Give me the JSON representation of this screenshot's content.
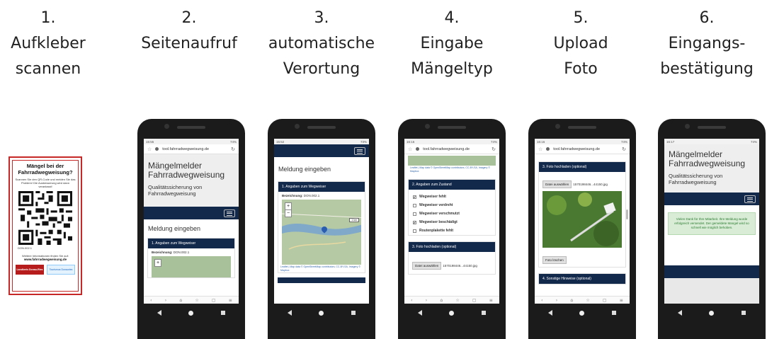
{
  "steps": [
    {
      "num": "1.",
      "line1": "Aufkleber",
      "line2": "scannen"
    },
    {
      "num": "2.",
      "line1": "Seitenaufruf",
      "line2": ""
    },
    {
      "num": "3.",
      "line1": "automatische",
      "line2": "Verortung"
    },
    {
      "num": "4.",
      "line1": "Eingabe",
      "line2": "Mängeltyp"
    },
    {
      "num": "5.",
      "line1": "Upload",
      "line2": "Foto"
    },
    {
      "num": "6.",
      "line1": "Eingangs-",
      "line2": "bestätigung"
    }
  ],
  "sticker": {
    "title": "Mängel bei der Fahrradwegweisung?",
    "text": "Scannen Sie den QR-Code und melden Sie das Problem! Die Ausbesserung wird dann veranlasst!",
    "id": "DON.002.1",
    "info": "Weitere Informationen finden Sie auf:",
    "url": "www.fahrradwegweisung.de",
    "logo_left": "Landkreis Donau-Ries",
    "logo_right": "Tourismus Donauries"
  },
  "phones": {
    "url": "tool.fahrradwegweisung.de",
    "app_title": "Mängelmelder Fahrradwegweisung",
    "app_subtitle": "Qualitätssicherung von Fahrradwegweisung",
    "status_times": [
      "15:55",
      "15:52",
      "16:16",
      "16:16",
      "16:17"
    ],
    "status_battery": [
      "74%",
      "73%",
      "74%",
      "74%",
      "74%"
    ],
    "page_heading": "Meldung eingeben",
    "section1": "1. Angaben zum Wegweiser",
    "bezeichnung_label": "Bezeichnung:",
    "bezeichnung_value": "DON.002.1",
    "map_attrib": "Leaflet | Map data © OpenStreetMap contributors, CC-BY-SA, Imagery © Mapbox",
    "map_scale": "1 km",
    "section2": "2. Angaben zum Zustand",
    "options": [
      {
        "label": "Wegweiser fehlt",
        "checked": true
      },
      {
        "label": "Wegweiser verdreht",
        "checked": false
      },
      {
        "label": "Wegweiser verschmutzt",
        "checked": false
      },
      {
        "label": "Wegweiser beschädigt",
        "checked": true
      },
      {
        "label": "Routenplakette fehlt",
        "checked": false
      }
    ],
    "section3": "3. Foto hochladen (optional)",
    "file_button": "Datei auswählen",
    "file_name": "1570198446...44150.jpg",
    "delete_photo": "Foto löschen",
    "section4": "4. Sonstige Hinweise (optional)",
    "success_text": "Vielen Dank für Ihre Mitarbeit. Ihre Meldung wurde erfolgreich versendet. Der gemeldete Mangel wird so schnell wie möglich behoben.",
    "badge_count": "5"
  }
}
